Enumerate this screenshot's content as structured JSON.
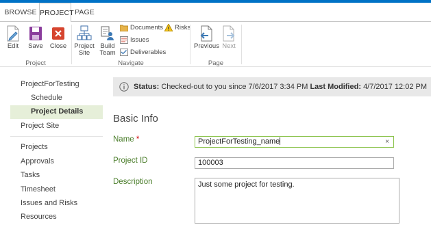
{
  "ribbon_tabs": [
    "BROWSE",
    "PROJECT",
    "PAGE"
  ],
  "ribbon": {
    "project_group": {
      "label": "Project",
      "edit": "Edit",
      "save": "Save",
      "close": "Close"
    },
    "navigate_group": {
      "label": "Navigate",
      "project_site": [
        "Project",
        "Site"
      ],
      "build_team": [
        "Build",
        "Team"
      ],
      "documents": "Documents",
      "risks": "Risks",
      "issues": "Issues",
      "deliverables": "Deliverables"
    },
    "page_group": {
      "label": "Page",
      "previous": "Previous",
      "next": "Next"
    }
  },
  "sidebar": {
    "project_name": "ProjectForTesting",
    "schedule": "Schedule",
    "project_details": "Project Details",
    "project_site": "Project Site",
    "links": [
      "Projects",
      "Approvals",
      "Tasks",
      "Timesheet",
      "Issues and Risks",
      "Resources"
    ]
  },
  "status": {
    "status_label": "Status:",
    "status_text": "Checked-out to you since 7/6/2017 3:34 PM",
    "modified_label": "Last Modified:",
    "modified_value": "4/7/2017 12:02 PM"
  },
  "form": {
    "section_title": "Basic Info",
    "name_label": "Name",
    "required_mark": "*",
    "name_value": "ProjectForTesting_name",
    "clear_glyph": "×",
    "project_id_label": "Project ID",
    "project_id_value": "100003",
    "description_label": "Description",
    "description_value": "Just some project for testing."
  },
  "colors": {
    "accent_blue": "#0072c6",
    "label_green": "#4a7d2a",
    "selected_nav_bg": "#e6efd9"
  }
}
